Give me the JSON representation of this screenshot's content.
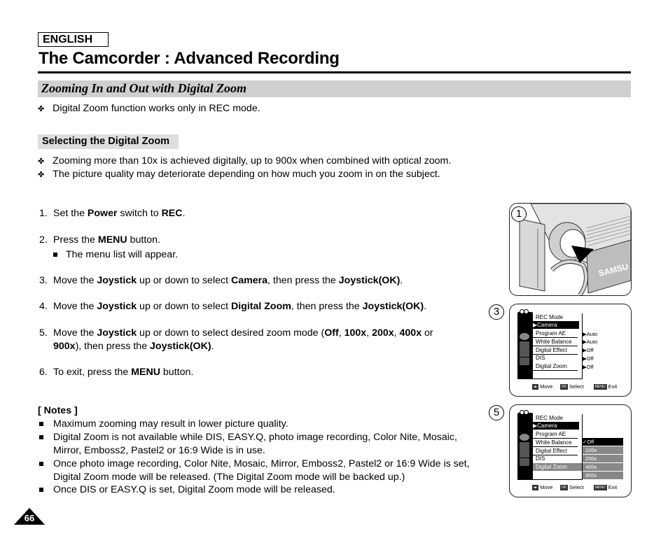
{
  "header": {
    "language_badge": "ENGLISH",
    "page_title": "The Camcorder : Advanced Recording"
  },
  "section": {
    "title": "Zooming In and Out with Digital Zoom",
    "intro_bullet": "Digital Zoom function works only in REC mode."
  },
  "subsection": {
    "title": "Selecting the Digital Zoom",
    "bullets": [
      "Zooming more than 10x is achieved digitally, up to 900x when combined with optical zoom.",
      "The picture quality may deteriorate depending on how much you zoom in on the subject."
    ]
  },
  "steps": [
    {
      "num": "1.",
      "parts": [
        "Set the ",
        "Power",
        " switch to ",
        "REC",
        "."
      ]
    },
    {
      "num": "2.",
      "parts": [
        "Press the ",
        "MENU",
        " button."
      ],
      "sub": "The menu list will appear."
    },
    {
      "num": "3.",
      "parts": [
        "Move the ",
        "Joystick",
        " up or down to select ",
        "Camera",
        ", then press the ",
        "Joystick(OK)",
        "."
      ]
    },
    {
      "num": "4.",
      "parts": [
        "Move the ",
        "Joystick",
        " up or down to select ",
        "Digital Zoom",
        ", then press the ",
        "Joystick(OK)",
        "."
      ]
    },
    {
      "num": "5.",
      "parts": [
        "Move the ",
        "Joystick",
        " up or down to select desired zoom mode (",
        "Off",
        ", ",
        "100x",
        ", ",
        "200x",
        ", ",
        "400x",
        " or"
      ],
      "parts2": [
        "900x",
        "), then press the ",
        "Joystick(OK)",
        "."
      ]
    },
    {
      "num": "6.",
      "parts": [
        "To exit, press the ",
        "MENU",
        " button."
      ]
    }
  ],
  "notes": {
    "title": "[ Notes ]",
    "items": [
      [
        "Maximum zooming may result in lower picture quality."
      ],
      [
        "Digital Zoom is not available while DIS, EASY.Q, photo image recording, Color Nite, Mosaic,",
        "Mirror, Emboss2, Pastel2 or 16:9 Wide is in use."
      ],
      [
        "Once photo image recording, Color Nite, Mosaic, Mirror, Emboss2, Pastel2 or 16:9 Wide is set,",
        "Digital Zoom mode will be released. (The Digital Zoom mode will be backed up.)"
      ],
      [
        "Once DIS or EASY.Q is set, Digital Zoom mode will be released."
      ]
    ]
  },
  "figures": {
    "fig1": {
      "num": "1",
      "brand_text": "SAMSU"
    },
    "fig3": {
      "num": "3",
      "menu_title": "REC Mode",
      "menu_selected": "▶Camera",
      "items": [
        "Program AE",
        "White Balance",
        "Digital Effect",
        "DIS",
        "Digital Zoom"
      ],
      "values": [
        "▶Auto",
        "▶Auto",
        "▶Off",
        "▶Off",
        "▶Off"
      ],
      "footer": {
        "move": "Move",
        "ok_chip": "OK",
        "select": "Select",
        "menu_chip": "MENU",
        "exit": "Exit"
      }
    },
    "fig5": {
      "num": "5",
      "menu_title": "REC Mode",
      "menu_selected": "▶Camera",
      "items": [
        "Program AE",
        "White Balance",
        "Digital Effect",
        "DIS",
        "Digital Zoom"
      ],
      "options": [
        "✓Off",
        "100x",
        "200x",
        "400x",
        "900x"
      ],
      "footer": {
        "move": "Move",
        "ok_chip": "OK",
        "select": "Select",
        "menu_chip": "MENU",
        "exit": "Exit"
      }
    }
  },
  "page_number": "66"
}
